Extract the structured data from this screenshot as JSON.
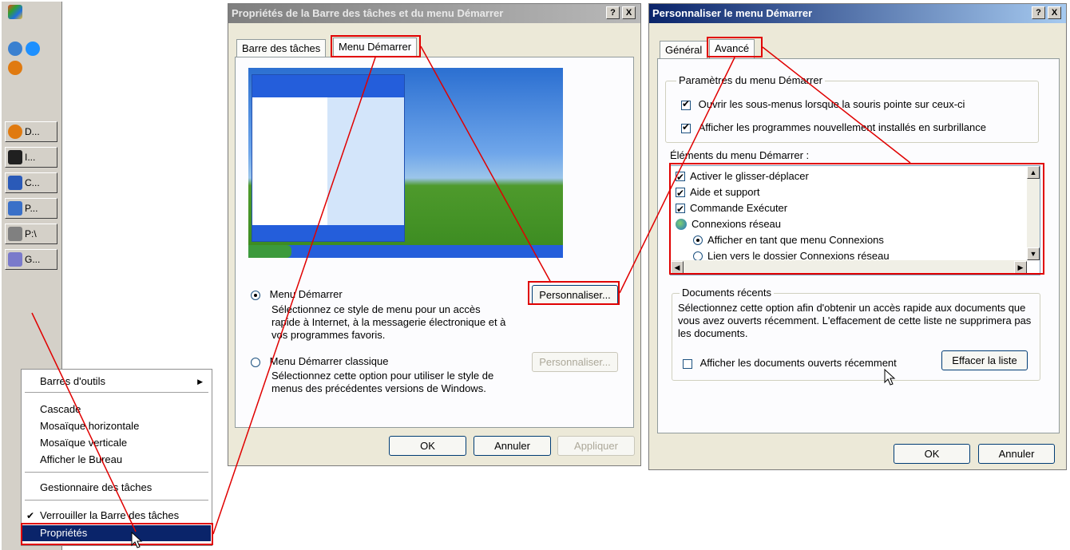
{
  "taskbar": {
    "buttons": [
      {
        "label": "D...",
        "icon": "firefox-icon",
        "color": "#e07a10"
      },
      {
        "label": "I...",
        "icon": "console-icon",
        "color": "#202020"
      },
      {
        "label": "C...",
        "icon": "word-icon",
        "color": "#2a5ab8"
      },
      {
        "label": "P...",
        "icon": "user-icon",
        "color": "#3a70c8"
      },
      {
        "label": "P:\\",
        "icon": "network-drive-icon",
        "color": "#808080"
      },
      {
        "label": "G...",
        "icon": "cube-icon",
        "color": "#7a7acb"
      }
    ]
  },
  "context_menu": {
    "items": [
      {
        "label": "Barres d'outils",
        "submenu": true
      },
      {
        "label": "Cascade"
      },
      {
        "label": "Mosaïque horizontale"
      },
      {
        "label": "Mosaïque verticale"
      },
      {
        "label": "Afficher le Bureau"
      },
      {
        "label": "Gestionnaire des tâches"
      },
      {
        "label": "Verrouiller la Barre des tâches",
        "checked": true
      },
      {
        "label": "Propriétés",
        "selected": true
      }
    ]
  },
  "dialog1": {
    "title": "Propriétés de la Barre des tâches et du menu Démarrer",
    "help_button": "?",
    "close_button": "X",
    "tabs": [
      "Barre des tâches",
      "Menu Démarrer"
    ],
    "active_tab": 1,
    "option1": {
      "label": "Menu Démarrer",
      "selected": true,
      "description": "Sélectionnez ce style de menu pour un accès rapide à Internet, à la messagerie électronique et à vos programmes favoris.",
      "button": "Personnaliser..."
    },
    "option2": {
      "label": "Menu Démarrer classique",
      "selected": false,
      "description": "Sélectionnez cette option pour utiliser le style de menus des précédentes versions de Windows.",
      "button": "Personnaliser..."
    },
    "buttons": {
      "ok": "OK",
      "cancel": "Annuler",
      "apply": "Appliquer"
    }
  },
  "dialog2": {
    "title": "Personnaliser le menu Démarrer",
    "help_button": "?",
    "close_button": "X",
    "tabs": [
      "Général",
      "Avancé"
    ],
    "active_tab": 1,
    "settings_group": {
      "legend": "Paramètres du menu Démarrer",
      "options": [
        {
          "label": "Ouvrir les sous-menus lorsque la souris pointe sur ceux-ci",
          "checked": true
        },
        {
          "label": "Afficher les programmes nouvellement installés en surbrillance",
          "checked": true
        }
      ]
    },
    "items_label": "Éléments du menu Démarrer :",
    "items": [
      {
        "label": "Activer le glisser-déplacer",
        "kind": "check",
        "checked": true
      },
      {
        "label": "Aide et support",
        "kind": "check",
        "checked": true
      },
      {
        "label": "Commande Exécuter",
        "kind": "check",
        "checked": true
      },
      {
        "label": "Connexions réseau",
        "kind": "icon",
        "icon": "network-globe-icon"
      },
      {
        "label": "Afficher en tant que menu Connexions",
        "kind": "radio",
        "checked": true
      },
      {
        "label": "Lien vers le dossier Connexions réseau",
        "kind": "radio",
        "checked": false
      }
    ],
    "recent_group": {
      "legend": "Documents récents",
      "description": "Sélectionnez cette option afin d'obtenir un accès rapide aux documents que vous avez ouverts récemment. L'effacement de cette liste ne supprimera pas les documents.",
      "checkbox": {
        "label": "Afficher les documents ouverts récemment",
        "checked": false
      },
      "clear_button": "Effacer la liste"
    },
    "buttons": {
      "ok": "OK",
      "cancel": "Annuler"
    }
  },
  "colors": {
    "annotation": "#e00000",
    "selection": "#0a246a",
    "dialog_bg": "#ece9d8"
  }
}
